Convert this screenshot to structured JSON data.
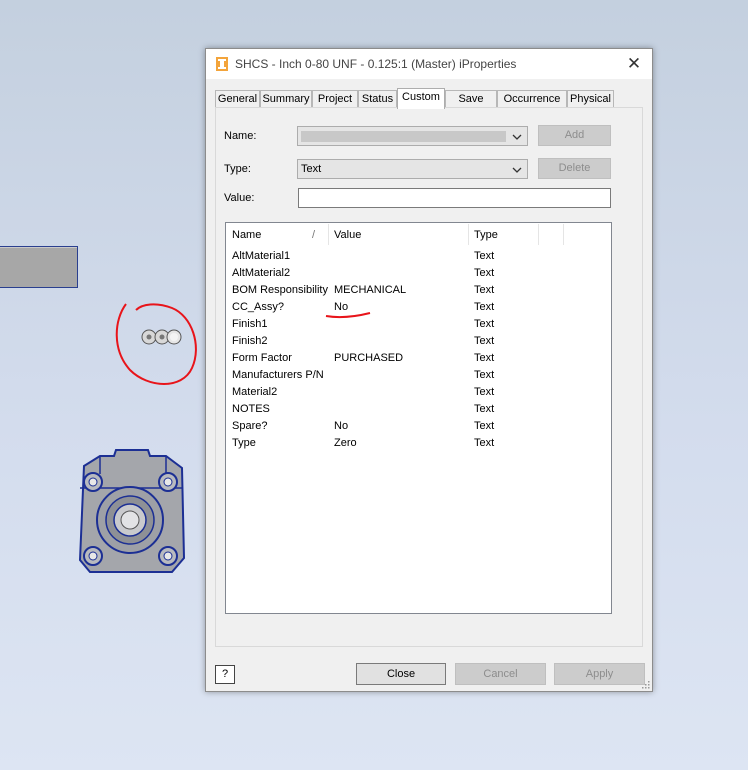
{
  "dialog": {
    "title": "SHCS - Inch 0-80 UNF - 0.125:1 (Master) iProperties",
    "close_glyph": "✕"
  },
  "tabs": [
    {
      "label": "General"
    },
    {
      "label": "Summary"
    },
    {
      "label": "Project"
    },
    {
      "label": "Status"
    },
    {
      "label": "Custom",
      "active": true
    },
    {
      "label": "Save"
    },
    {
      "label": "Occurrence"
    },
    {
      "label": "Physical"
    }
  ],
  "form": {
    "name_label": "Name:",
    "type_label": "Type:",
    "type_value": "Text",
    "value_label": "Value:",
    "value_text": "",
    "add_label": "Add",
    "delete_label": "Delete"
  },
  "list": {
    "headers": {
      "name": "Name",
      "value": "Value",
      "type": "Type"
    },
    "sort_indicator": "/",
    "rows": [
      {
        "name": "AltMaterial1",
        "value": "",
        "type": "Text"
      },
      {
        "name": "AltMaterial2",
        "value": "",
        "type": "Text"
      },
      {
        "name": "BOM Responsibility",
        "value": "MECHANICAL",
        "type": "Text"
      },
      {
        "name": "CC_Assy?",
        "value": "No",
        "type": "Text"
      },
      {
        "name": "Finish1",
        "value": "",
        "type": "Text"
      },
      {
        "name": "Finish2",
        "value": "",
        "type": "Text"
      },
      {
        "name": "Form Factor",
        "value": "PURCHASED",
        "type": "Text"
      },
      {
        "name": "Manufacturers P/N",
        "value": "",
        "type": "Text"
      },
      {
        "name": "Material2",
        "value": "",
        "type": "Text"
      },
      {
        "name": "NOTES",
        "value": "",
        "type": "Text"
      },
      {
        "name": "Spare?",
        "value": "No",
        "type": "Text"
      },
      {
        "name": "Type",
        "value": "Zero",
        "type": "Text"
      }
    ]
  },
  "buttons": {
    "help_glyph": "?",
    "close_label": "Close",
    "cancel_label": "Cancel",
    "apply_label": "Apply"
  },
  "colors": {
    "annotation_red": "#e8141a",
    "part_edge_blue": "#1c2f94",
    "part_fill_gray": "#a4a6ab"
  },
  "icons": {
    "app": "inventor-iproperties-icon",
    "close": "close-icon",
    "dropdown": "chevron-down-icon",
    "help": "help-icon"
  }
}
